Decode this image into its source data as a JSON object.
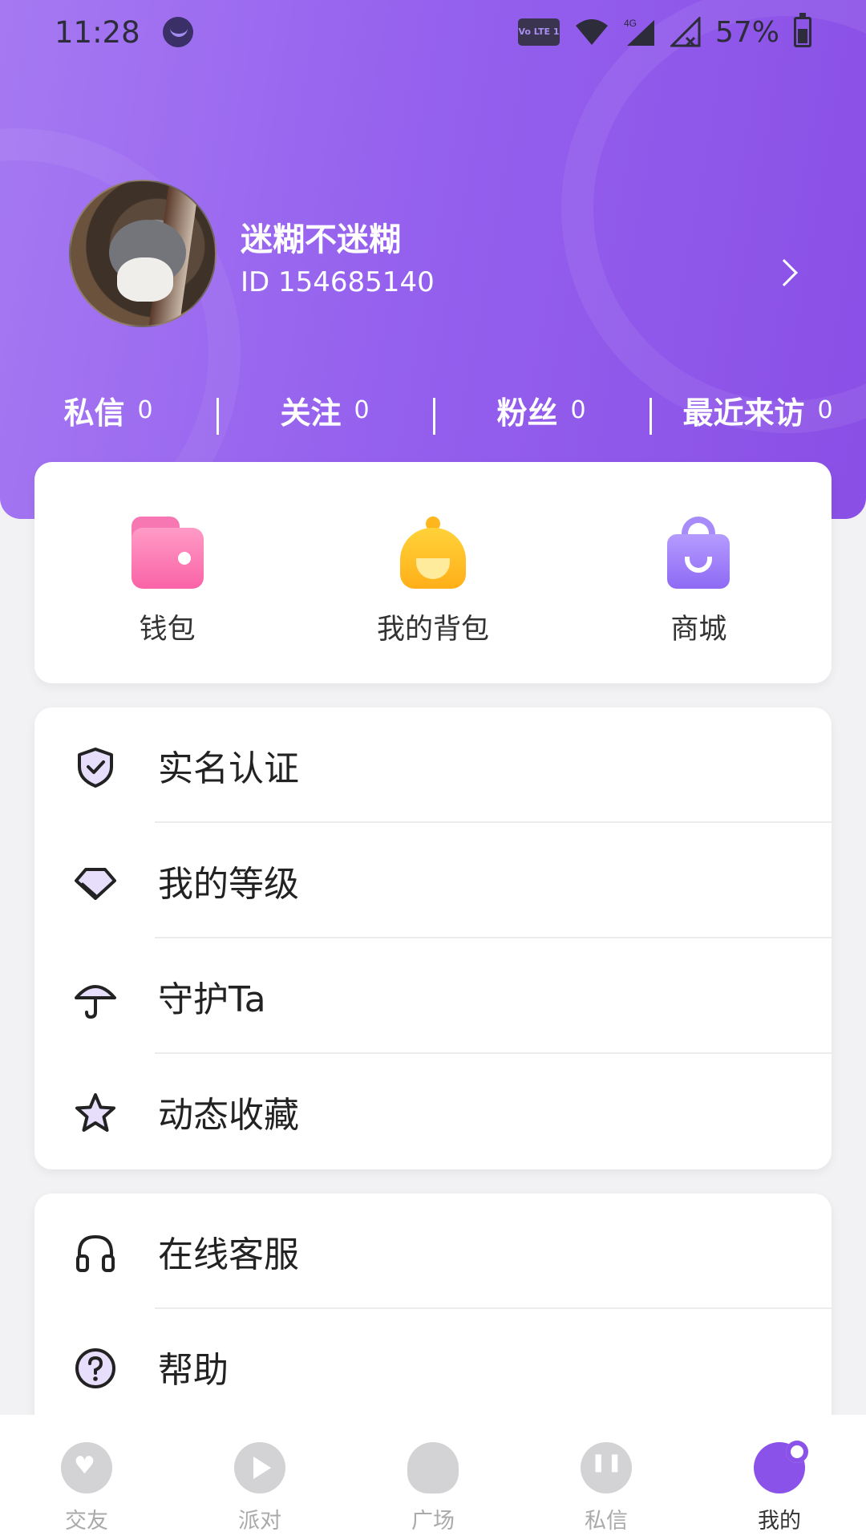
{
  "status_bar": {
    "time": "11:28",
    "volte_label": "Vo LTE 1",
    "network_label": "4G",
    "battery_percent": "57%"
  },
  "profile": {
    "username": "迷糊不迷糊",
    "user_id": "ID 154685140"
  },
  "stats": [
    {
      "label": "私信",
      "count": "0"
    },
    {
      "label": "关注",
      "count": "0"
    },
    {
      "label": "粉丝",
      "count": "0"
    },
    {
      "label": "最近来访",
      "count": "0"
    }
  ],
  "quick_actions": [
    {
      "label": "钱包",
      "icon": "wallet-icon"
    },
    {
      "label": "我的背包",
      "icon": "backpack-icon"
    },
    {
      "label": "商城",
      "icon": "shopping-bag-icon"
    }
  ],
  "menu_group_1": [
    {
      "label": "实名认证",
      "icon": "shield-check-icon"
    },
    {
      "label": "我的等级",
      "icon": "diamond-icon"
    },
    {
      "label": "守护Ta",
      "icon": "umbrella-icon"
    },
    {
      "label": "动态收藏",
      "icon": "star-icon"
    }
  ],
  "menu_group_2": [
    {
      "label": "在线客服",
      "icon": "headphones-icon"
    },
    {
      "label": "帮助",
      "icon": "help-circle-icon"
    }
  ],
  "bottom_nav": [
    {
      "label": "交友",
      "icon": "heart-icon",
      "active": false
    },
    {
      "label": "派对",
      "icon": "play-icon",
      "active": false
    },
    {
      "label": "广场",
      "icon": "square-icon",
      "active": false
    },
    {
      "label": "私信",
      "icon": "chat-icon",
      "active": false
    },
    {
      "label": "我的",
      "icon": "profile-icon",
      "active": true
    }
  ],
  "colors": {
    "accent": "#8a52e8",
    "header_start": "#a679f2",
    "header_end": "#8a4fe6"
  }
}
